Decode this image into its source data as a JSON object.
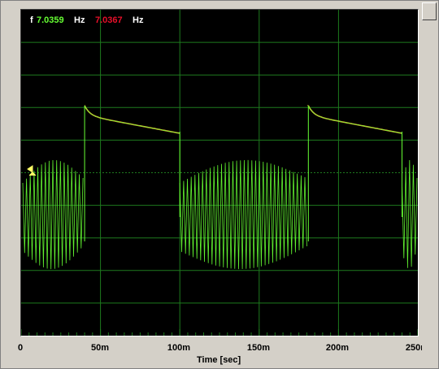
{
  "readouts": {
    "label": "f",
    "freq1": "7.0359",
    "unit1": "Hz",
    "freq2": "7.0367",
    "unit2": "Hz"
  },
  "colors": {
    "trace_primary": "#66ff33",
    "trace_secondary": "#ff9a33",
    "grid": "#1e7a1e",
    "background": "#000000"
  },
  "chart_data": {
    "type": "line",
    "xlabel": "Time [sec]",
    "xlim": [
      0,
      0.25
    ],
    "x_tick_labels": [
      "0",
      "50m",
      "100m",
      "150m",
      "200m",
      "250m"
    ],
    "grid": true,
    "series": [
      {
        "points": [
          [
            0.0,
            0.0
          ],
          [
            0.039,
            0.0
          ],
          [
            0.04,
            1.0
          ],
          [
            0.05,
            0.88
          ],
          [
            0.07,
            0.78
          ],
          [
            0.1,
            0.66
          ],
          [
            0.1,
            0.0
          ],
          [
            0.18,
            0.0
          ],
          [
            0.181,
            1.0
          ],
          [
            0.2,
            0.85
          ],
          [
            0.24,
            0.66
          ],
          [
            0.24,
            0.0
          ],
          [
            0.25,
            0.0
          ]
        ]
      }
    ]
  },
  "scrollbar": {
    "visible": true
  }
}
